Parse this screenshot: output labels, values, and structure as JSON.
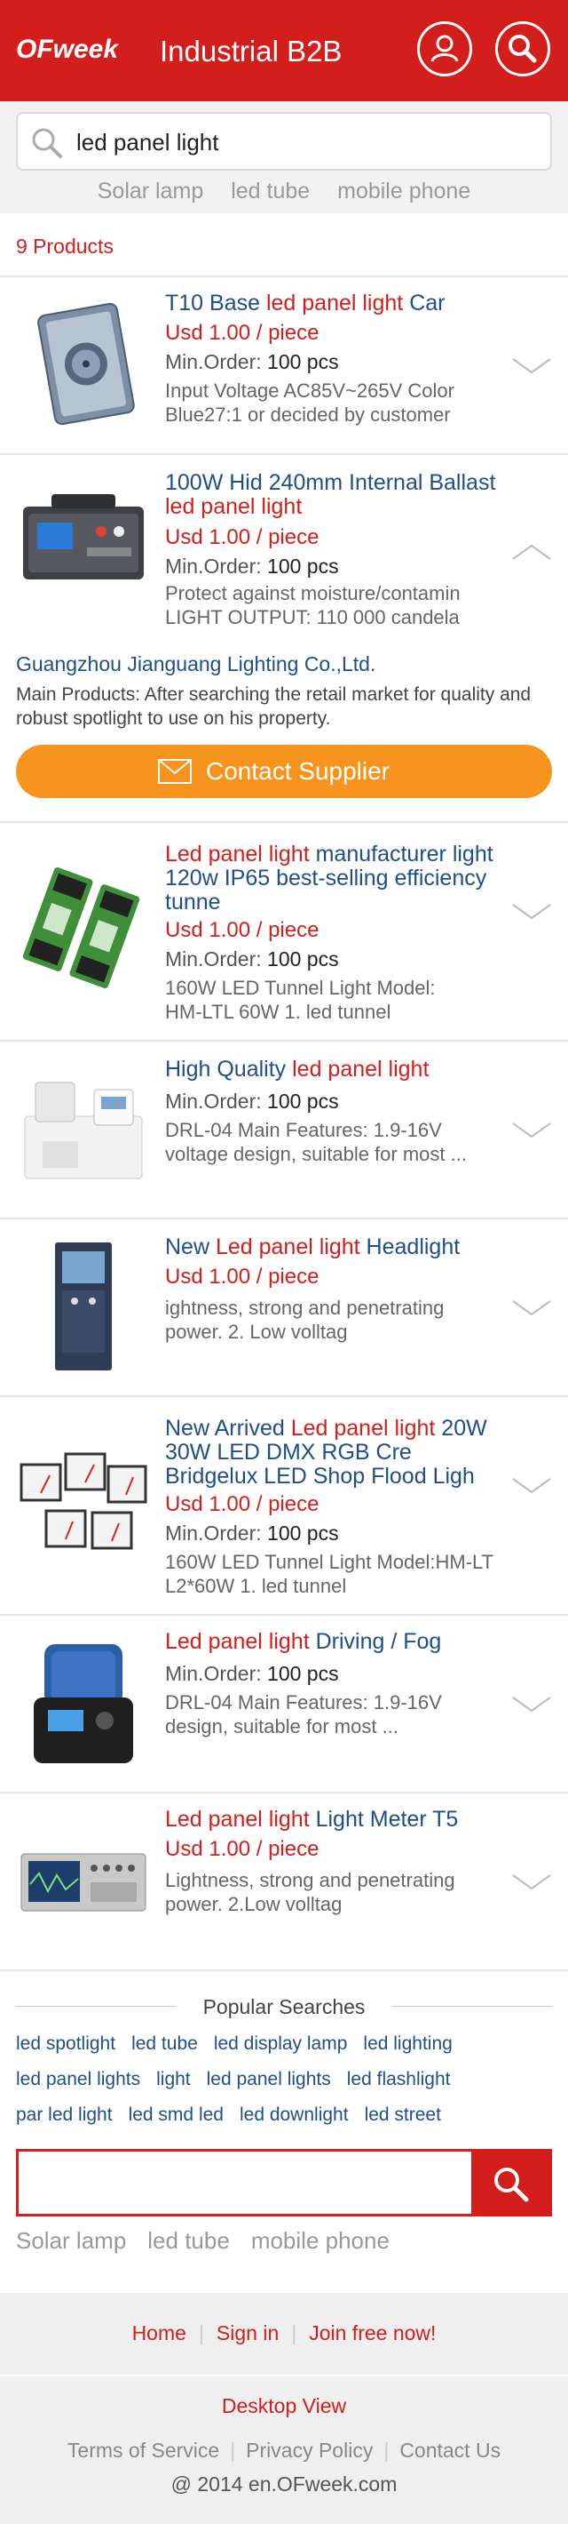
{
  "header": {
    "logo_text": "OFweek",
    "title": "Industrial B2B",
    "bg_color": "#d41e1b"
  },
  "search": {
    "query": "led panel light",
    "hints": [
      "Solar lamp",
      "led tube",
      "mobile phone"
    ]
  },
  "results": {
    "count_label": "9 Products"
  },
  "products": [
    {
      "title_parts": [
        {
          "t": "T10 Base ",
          "hl": false
        },
        {
          "t": "led panel light",
          "hl": true
        },
        {
          "t": " Car",
          "hl": false
        }
      ],
      "price": "Usd 1.00 / piece",
      "moq_label": "Min.Order:",
      "moq_value": "100 pcs",
      "desc": "Input Voltage  AC85V~265V Color\nBlue27:1 or decided by customer",
      "image": "smart-switch-panel",
      "expanded": false
    },
    {
      "title_parts": [
        {
          "t": "100W Hid 240mm Internal Ballast ",
          "hl": false
        },
        {
          "t": "led panel light",
          "hl": true
        }
      ],
      "price": "Usd 1.00 / piece",
      "moq_label": "Min.Order:",
      "moq_value": "100 pcs",
      "desc": "Protect against moisture/contamin\nLIGHT OUTPUT: 110 000 candela",
      "image": "test-instrument",
      "expanded": true
    },
    {
      "title_parts": [
        {
          "t": "Led panel light",
          "hl": true
        },
        {
          "t": " manufacturer light 120w IP65 best-selling efficiency tunne",
          "hl": false
        }
      ],
      "price": "Usd 1.00 / piece",
      "moq_label": "Min.Order:",
      "moq_value": "100 pcs",
      "desc": "160W LED Tunnel Light Model:\nHM-LTL 60W 1. led tunnel",
      "image": "din-rail-modules",
      "expanded": false
    },
    {
      "title_parts": [
        {
          "t": "High Quality ",
          "hl": false
        },
        {
          "t": "led panel light",
          "hl": true
        }
      ],
      "price": "",
      "moq_label": "Min.Order:",
      "moq_value": "100 pcs",
      "desc": "DRL-04 Main Features: 1.9-16V\nvoltage design, suitable for most ...",
      "image": "lab-analyzer",
      "expanded": false
    },
    {
      "title_parts": [
        {
          "t": "New ",
          "hl": false
        },
        {
          "t": "Led panel light",
          "hl": true
        },
        {
          "t": " Headlight",
          "hl": false
        }
      ],
      "price": "Usd 1.00 / piece",
      "moq_label": "",
      "moq_value": "",
      "desc": "ightness, strong and penetrating\npower. 2. Low volltag",
      "image": "control-cabinet",
      "expanded": false
    },
    {
      "title_parts": [
        {
          "t": "New Arrived ",
          "hl": false
        },
        {
          "t": "Led panel light",
          "hl": true
        },
        {
          "t": " 20W 30W LED DMX RGB Cre Bridgelux LED Shop Flood Ligh",
          "hl": false
        }
      ],
      "price": "Usd 1.00 / piece",
      "moq_label": "Min.Order:",
      "moq_value": "100 pcs",
      "desc": "160W LED Tunnel Light Model:HM-LT\nL2*60W 1. led tunnel",
      "image": "panel-meters",
      "expanded": false
    },
    {
      "title_parts": [
        {
          "t": "Led panel light",
          "hl": true
        },
        {
          "t": " Driving / Fog",
          "hl": false
        }
      ],
      "price": "",
      "moq_label": "Min.Order:",
      "moq_value": "100 pcs",
      "desc": "DRL-04 Main Features: 1.9-16V\ndesign, suitable for most ...",
      "image": "mixer-machine",
      "expanded": false
    },
    {
      "title_parts": [
        {
          "t": "Led panel light",
          "hl": true
        },
        {
          "t": " Light Meter T5",
          "hl": false
        }
      ],
      "price": "Usd 1.00 / piece",
      "moq_label": "",
      "moq_value": "",
      "desc": "Lightness, strong and penetrating\npower. 2.Low volltag",
      "image": "oscilloscope",
      "expanded": false
    }
  ],
  "supplier": {
    "name": "Guangzhou Jianguang Lighting Co.,Ltd.",
    "main_products": "Main Products: After searching the retail market for quality and robust spotlight to use on his property.",
    "contact_label": "Contact Supplier"
  },
  "popular": {
    "heading": "Popular Searches",
    "rows": [
      [
        "led spotlight",
        "led tube",
        "led display lamp",
        "led lighting"
      ],
      [
        "led panel lights",
        "light",
        "led panel lights",
        "led flashlight"
      ],
      [
        "par led light",
        "led smd led",
        "led downlight",
        "led street"
      ]
    ]
  },
  "bottom_search": {
    "value": "",
    "hints": [
      "Solar lamp",
      "led tube",
      "mobile phone"
    ]
  },
  "footer": {
    "nav": [
      "Home",
      "Sign in",
      "Join free now!"
    ],
    "desktop": "Desktop View",
    "links": [
      "Terms of Service",
      "Privacy Policy",
      "Contact Us"
    ],
    "copyright": "@ 2014 en.OFweek.com"
  }
}
